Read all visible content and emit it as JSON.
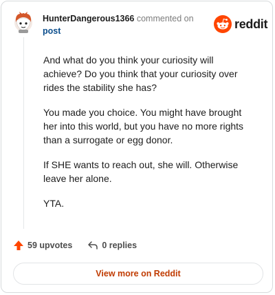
{
  "header": {
    "username": "HunterDangerous1366",
    "commented_on": "commented on",
    "post_link": "post"
  },
  "brand": {
    "wordmark": "reddit",
    "color": "#ff4500"
  },
  "comment": {
    "paragraphs": [
      "And what do you think your curiosity will achieve? Do you think that your curiosity over rides the stability she has?",
      "You made you choice. You might have brought her into this world, but you have no more rights than a surrogate or egg donor.",
      "If SHE wants to reach out, she will. Otherwise leave her alone.",
      "YTA."
    ]
  },
  "footer": {
    "upvotes": "59 upvotes",
    "replies": "0 replies",
    "upvote_icon": "upvote-arrow-icon",
    "reply_icon": "reply-arrow-icon"
  },
  "view_more_label": "View more on Reddit"
}
